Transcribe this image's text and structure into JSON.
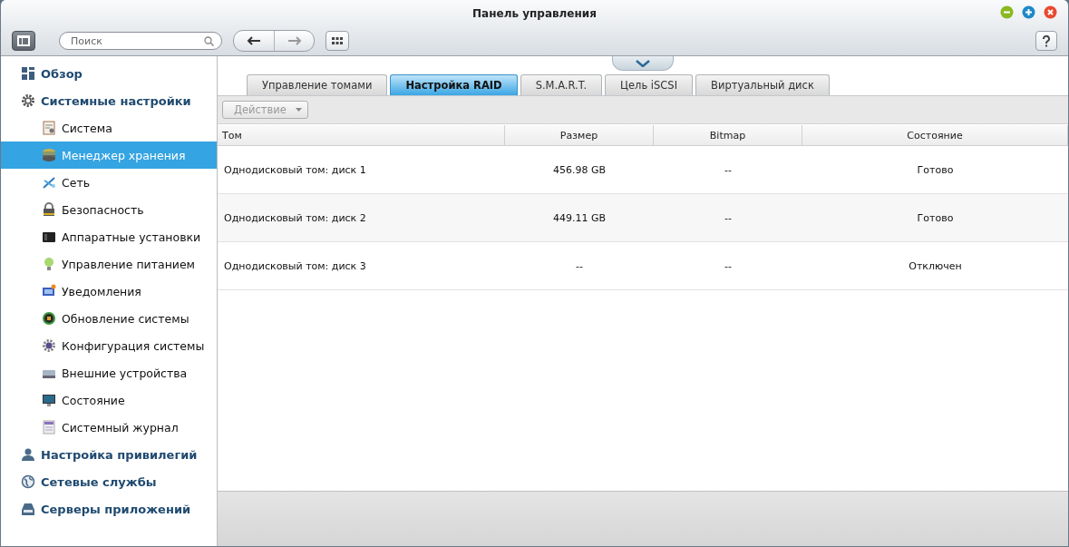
{
  "window": {
    "title": "Панель управления"
  },
  "toolbar": {
    "search": {
      "placeholder": "Поиск"
    }
  },
  "sidebar": {
    "items": [
      {
        "label": "Обзор",
        "selected": false
      },
      {
        "label": "Системные настройки",
        "selected": false,
        "children": [
          {
            "label": "Система",
            "selected": false
          },
          {
            "label": "Менеджер хранения",
            "selected": true
          },
          {
            "label": "Сеть",
            "selected": false
          },
          {
            "label": "Безопасность",
            "selected": false
          },
          {
            "label": "Аппаратные установки",
            "selected": false
          },
          {
            "label": "Управление питанием",
            "selected": false
          },
          {
            "label": "Уведомления",
            "selected": false
          },
          {
            "label": "Обновление системы",
            "selected": false
          },
          {
            "label": "Конфигурация системы",
            "selected": false
          },
          {
            "label": "Внешние устройства",
            "selected": false
          },
          {
            "label": "Состояние",
            "selected": false
          },
          {
            "label": "Системный журнал",
            "selected": false
          }
        ]
      },
      {
        "label": "Настройка привилегий",
        "selected": false
      },
      {
        "label": "Сетевые службы",
        "selected": false
      },
      {
        "label": "Серверы приложений",
        "selected": false
      }
    ]
  },
  "tabs": [
    {
      "label": "Управление томами",
      "selected": false
    },
    {
      "label": "Настройка RAID",
      "selected": true
    },
    {
      "label": "S.M.A.R.T.",
      "selected": false
    },
    {
      "label": "Цель iSCSI",
      "selected": false
    },
    {
      "label": "Виртуальный диск",
      "selected": false
    }
  ],
  "action_button": {
    "label": "Действие",
    "disabled": true
  },
  "table": {
    "columns": [
      "Том",
      "Размер",
      "Bitmap",
      "Состояние"
    ],
    "rows": [
      [
        "Однодисковый том: диск 1",
        "456.98 GB",
        "--",
        "Готово"
      ],
      [
        "Однодисковый том: диск 2",
        "449.11 GB",
        "--",
        "Готово"
      ],
      [
        "Однодисковый том: диск 3",
        "--",
        "--",
        "Отключен"
      ]
    ]
  }
}
